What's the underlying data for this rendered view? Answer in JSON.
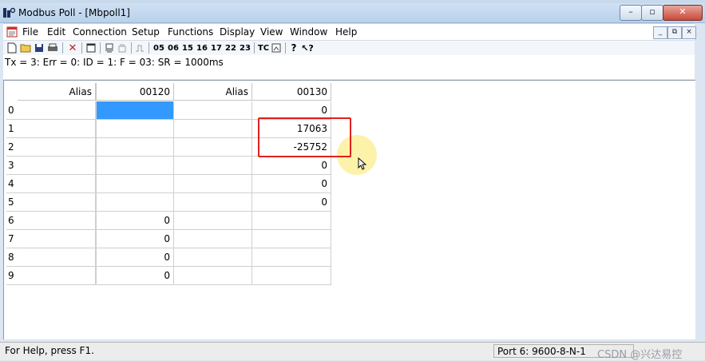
{
  "window": {
    "title": "Modbus Poll - [Mbpoll1]"
  },
  "menu": [
    "File",
    "Edit",
    "Connection",
    "Setup",
    "Functions",
    "Display",
    "View",
    "Window",
    "Help"
  ],
  "toolbar": {
    "fc_buttons": [
      "05",
      "06",
      "15",
      "16",
      "17",
      "22",
      "23"
    ],
    "tc_label": "TC"
  },
  "status_line": "Tx = 3: Err = 0: ID = 1: F = 03: SR = 1000ms",
  "grid": {
    "headers": [
      "Alias",
      "00120",
      "Alias",
      "00130"
    ],
    "rows": [
      {
        "num": "0",
        "c1": "",
        "c2": "",
        "c3": "0"
      },
      {
        "num": "1",
        "c1": "",
        "c2": "",
        "c3": "17063"
      },
      {
        "num": "2",
        "c1": "",
        "c2": "",
        "c3": "-25752"
      },
      {
        "num": "3",
        "c1": "",
        "c2": "",
        "c3": "0"
      },
      {
        "num": "4",
        "c1": "",
        "c2": "",
        "c3": "0"
      },
      {
        "num": "5",
        "c1": "",
        "c2": "",
        "c3": "0"
      },
      {
        "num": "6",
        "c1": "0",
        "c2": "",
        "c3": ""
      },
      {
        "num": "7",
        "c1": "0",
        "c2": "",
        "c3": ""
      },
      {
        "num": "8",
        "c1": "0",
        "c2": "",
        "c3": ""
      },
      {
        "num": "9",
        "c1": "0",
        "c2": "",
        "c3": ""
      }
    ]
  },
  "statusbar": {
    "help": "For Help, press F1.",
    "port": "Port 6: 9600-8-N-1",
    "watermark": "CSDN @兴达易控"
  },
  "colors": {
    "selection": "#3399ff",
    "highlight": "#e0211d"
  }
}
